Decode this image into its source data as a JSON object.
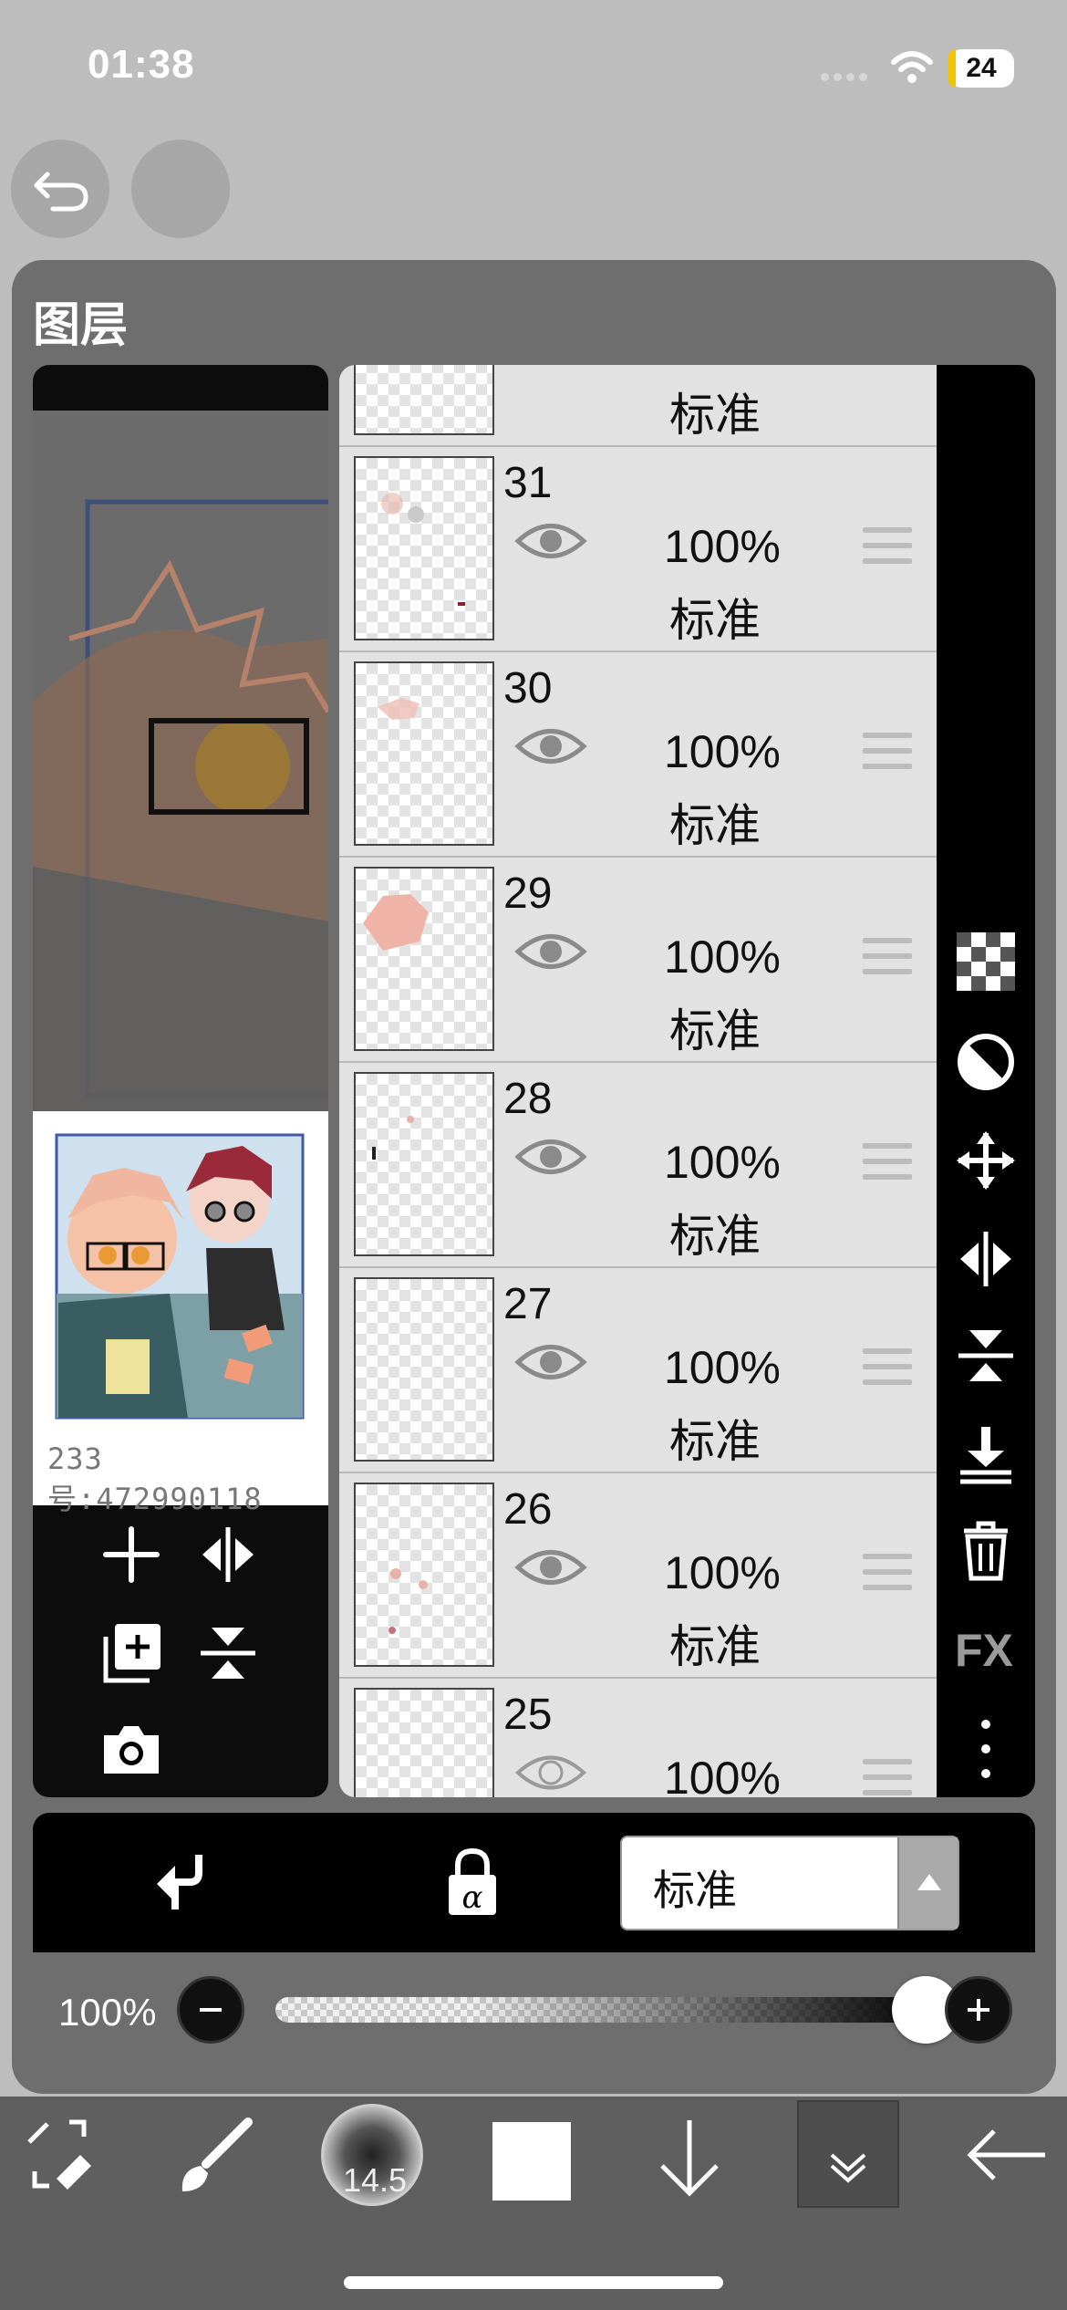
{
  "status_bar": {
    "time": "01:38",
    "battery": "24"
  },
  "panel": {
    "title": "图层",
    "thumbnail_caption": "233号:472990118"
  },
  "layers": [
    {
      "number": "",
      "opacity": "",
      "blend": "标准",
      "visible": true
    },
    {
      "number": "31",
      "opacity": "100%",
      "blend": "标准",
      "visible": true
    },
    {
      "number": "30",
      "opacity": "100%",
      "blend": "标准",
      "visible": true
    },
    {
      "number": "29",
      "opacity": "100%",
      "blend": "标准",
      "visible": true
    },
    {
      "number": "28",
      "opacity": "100%",
      "blend": "标准",
      "visible": true
    },
    {
      "number": "27",
      "opacity": "100%",
      "blend": "标准",
      "visible": true
    },
    {
      "number": "26",
      "opacity": "100%",
      "blend": "标准",
      "visible": true
    },
    {
      "number": "25",
      "opacity": "100%",
      "blend": "",
      "visible": false
    }
  ],
  "right_toolbar": {
    "fx_label": "FX"
  },
  "blend_mode": {
    "selected": "标准"
  },
  "opacity": {
    "label": "100%",
    "value_fraction": 1.0
  },
  "bottom_toolbar": {
    "brush_size": "14.5",
    "color": "#ffffff"
  },
  "colors": {
    "panel_bg": "#6e6e6e",
    "toolbar_bg": "#000000",
    "list_bg": "#e2e2e3"
  }
}
